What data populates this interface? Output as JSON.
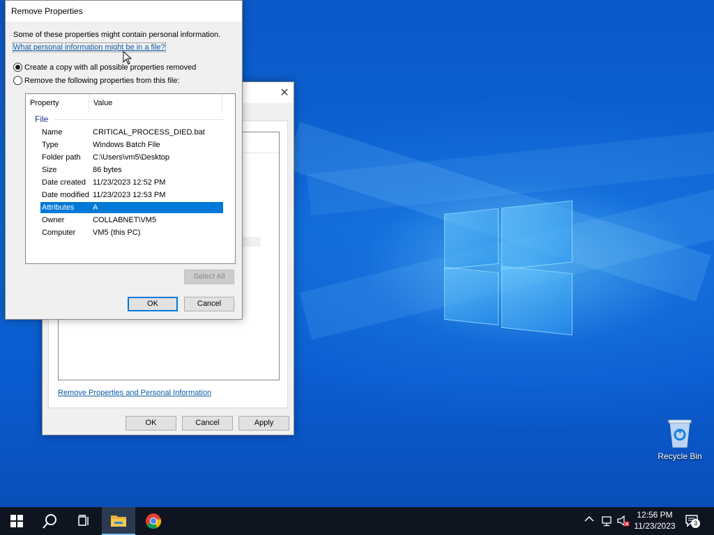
{
  "desktop": {
    "recycle_bin_label": "Recycle Bin"
  },
  "back_window": {
    "link": "Remove Properties and Personal Information",
    "ok": "OK",
    "cancel": "Cancel",
    "apply": "Apply"
  },
  "dialog": {
    "title": "Remove Properties",
    "intro": "Some of these properties might contain personal information.",
    "help_link": "What personal information might be in a file?",
    "option_copy": "Create a copy with all possible properties removed",
    "option_remove": "Remove the following properties from this file:",
    "selected_option": "copy",
    "columns": {
      "property": "Property",
      "value": "Value"
    },
    "group": "File",
    "rows": [
      {
        "k": "Name",
        "v": "CRITICAL_PROCESS_DIED.bat"
      },
      {
        "k": "Type",
        "v": "Windows Batch File"
      },
      {
        "k": "Folder path",
        "v": "C:\\Users\\vm5\\Desktop"
      },
      {
        "k": "Size",
        "v": "86 bytes"
      },
      {
        "k": "Date created",
        "v": "11/23/2023 12:52 PM"
      },
      {
        "k": "Date modified",
        "v": "11/23/2023 12:53 PM"
      },
      {
        "k": "Attributes",
        "v": "A"
      },
      {
        "k": "Owner",
        "v": "COLLABNET\\VM5"
      },
      {
        "k": "Computer",
        "v": "VM5 (this PC)"
      }
    ],
    "selected_row": "Attributes",
    "select_all": "Select All",
    "ok": "OK",
    "cancel": "Cancel"
  },
  "taskbar": {
    "time": "12:56 PM",
    "date": "11/23/2023",
    "notification_count": "3",
    "icons": [
      "windows-start-icon",
      "search-icon",
      "task-view-icon",
      "file-explorer-icon",
      "chrome-icon"
    ]
  },
  "colors": {
    "selection": "#0078d7",
    "link": "#0d5aa7",
    "taskbar": "#0f1520"
  }
}
